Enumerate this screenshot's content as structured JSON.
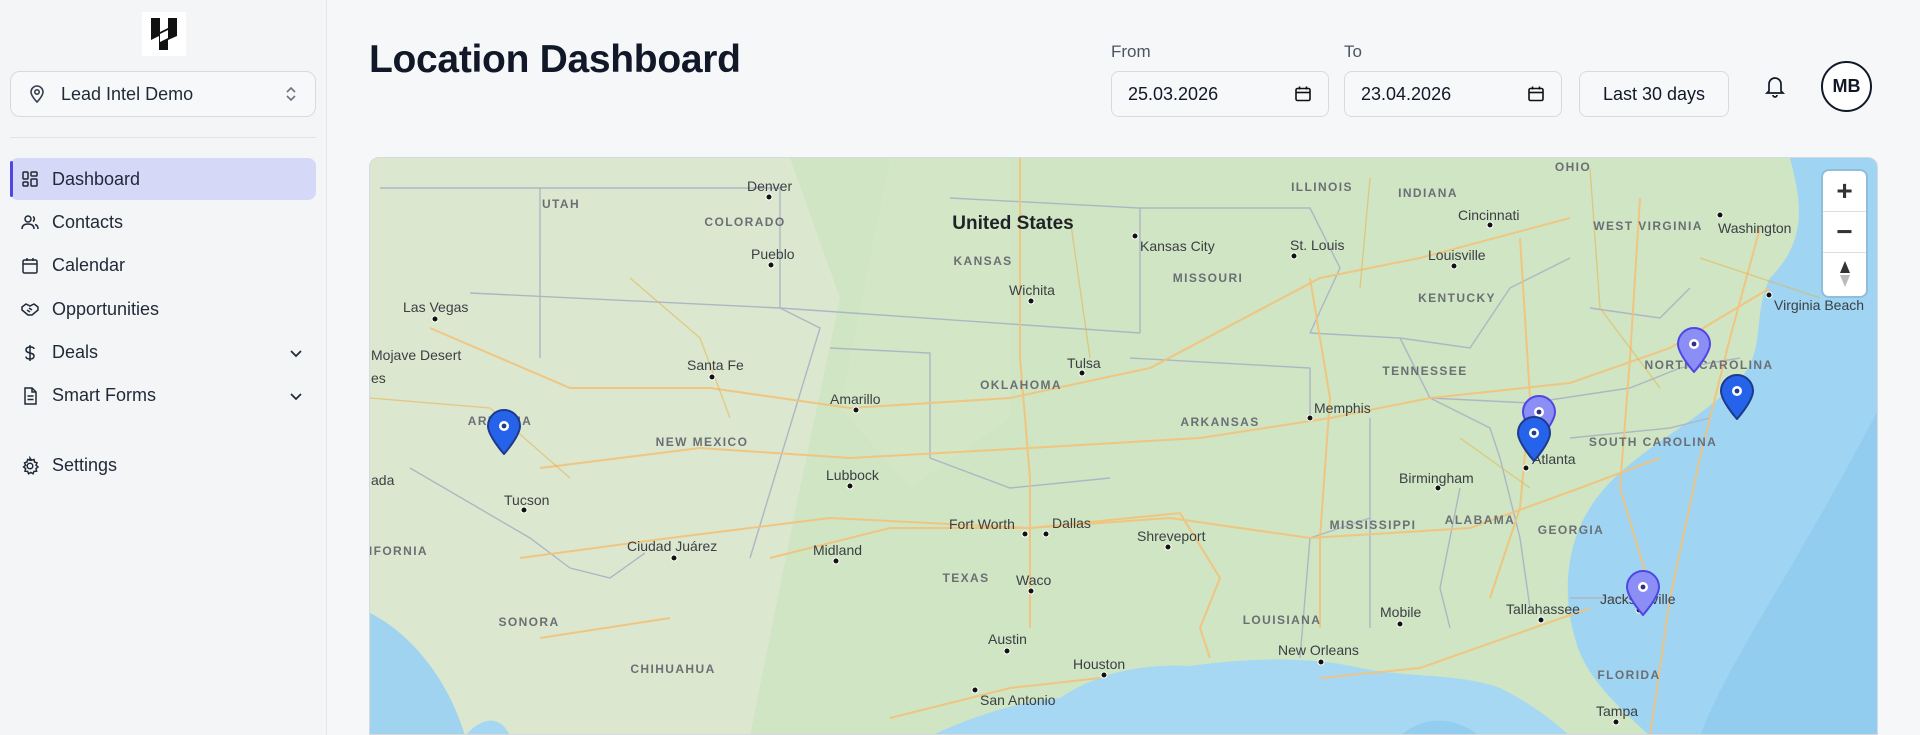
{
  "sidebar": {
    "org_name": "Lead Intel Demo",
    "items": [
      {
        "label": "Dashboard",
        "icon": "dashboard-icon"
      },
      {
        "label": "Contacts",
        "icon": "users-icon"
      },
      {
        "label": "Calendar",
        "icon": "calendar-icon"
      },
      {
        "label": "Opportunities",
        "icon": "handshake-icon"
      },
      {
        "label": "Deals",
        "icon": "dollar-icon"
      },
      {
        "label": "Smart Forms",
        "icon": "form-icon"
      },
      {
        "label": "Settings",
        "icon": "gear-icon"
      }
    ]
  },
  "header": {
    "title": "Location Dashboard",
    "from_label": "From",
    "from_value": "25.03.2026",
    "to_label": "To",
    "to_value": "23.04.2026",
    "range_label": "Last 30 days",
    "avatar_initials": "MB"
  },
  "map": {
    "country": "United States",
    "states": [
      "UTAH",
      "COLORADO",
      "KANSAS",
      "MISSOURI",
      "ILLINOIS",
      "INDIANA",
      "OHIO",
      "WEST VIRGINIA",
      "KENTUCKY",
      "TENNESSEE",
      "NORTH CAROLINA",
      "SOUTH CAROLINA",
      "OKLAHOMA",
      "ARKANSAS",
      "NEW MEXICO",
      "ARIZONA",
      "TEXAS",
      "MISSISSIPPI",
      "ALABAMA",
      "GEORGIA",
      "LOUISIANA",
      "FLORIDA",
      "SONORA",
      "CHIHUAHUA",
      "CALIFORNIA"
    ],
    "cities": [
      "Denver",
      "Pueblo",
      "Las Vegas",
      "Mojave Desert",
      "Santa Fe",
      "Amarillo",
      "Lubbock",
      "Tucson",
      "Ciudad Juárez",
      "Midland",
      "Wichita",
      "Kansas City",
      "St. Louis",
      "Tulsa",
      "Memphis",
      "Fort Worth",
      "Dallas",
      "Waco",
      "Austin",
      "Houston",
      "San Antonio",
      "Shreveport",
      "Birmingham",
      "Atlanta",
      "Mobile",
      "New Orleans",
      "Tallahassee",
      "Jacksonville",
      "Tampa",
      "Louisville",
      "Cincinnati",
      "Washington",
      "Virginia Beach",
      "es",
      "ada"
    ],
    "zoom_in": "+",
    "zoom_out": "−"
  }
}
